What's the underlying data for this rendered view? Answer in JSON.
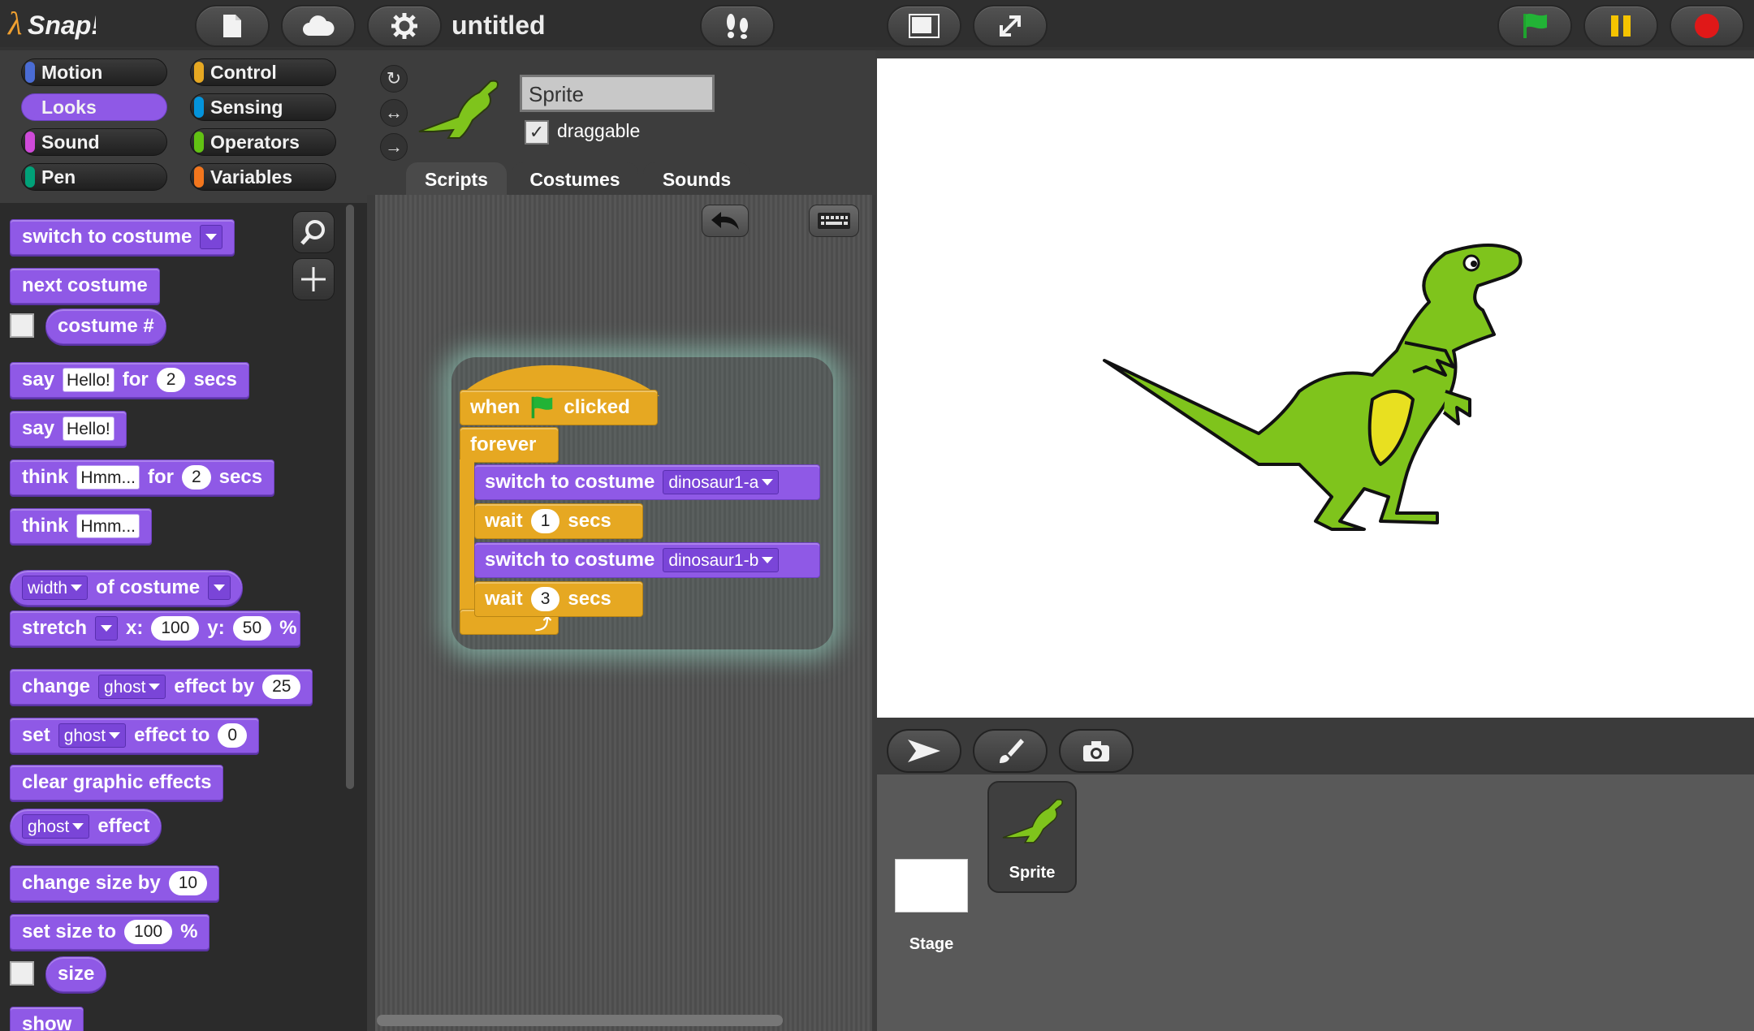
{
  "app": {
    "name": "Snap!",
    "project_title": "untitled"
  },
  "categories": [
    {
      "label": "Motion",
      "color": "#4a6cd4"
    },
    {
      "label": "Control",
      "color": "#e6a822"
    },
    {
      "label": "Looks",
      "color": "#8f59e6",
      "selected": true
    },
    {
      "label": "Sensing",
      "color": "#0494dc"
    },
    {
      "label": "Sound",
      "color": "#cf4ad9"
    },
    {
      "label": "Operators",
      "color": "#62c213"
    },
    {
      "label": "Pen",
      "color": "#00a178"
    },
    {
      "label": "Variables",
      "color": "#f3761d"
    }
  ],
  "palette": {
    "switch_to_costume": "switch to costume",
    "next_costume": "next costume",
    "costume_num": "costume #",
    "say": "say",
    "hello": "Hello!",
    "for": "for",
    "two": "2",
    "secs": "secs",
    "think": "think",
    "hmm": "Hmm...",
    "width": "width",
    "of_costume": "of costume",
    "stretch": "stretch",
    "x": "x:",
    "x_val": "100",
    "y": "y:",
    "y_val": "50",
    "pct": "%",
    "change": "change",
    "ghost": "ghost",
    "effect_by": "effect by",
    "twenty_five": "25",
    "set": "set",
    "effect_to": "effect to",
    "zero": "0",
    "clear_graphic_effects": "clear graphic effects",
    "effect": "effect",
    "change_size_by": "change size by",
    "ten": "10",
    "set_size_to": "set size to",
    "hundred": "100",
    "size": "size",
    "show": "show"
  },
  "sprite": {
    "name": "Sprite",
    "draggable_label": "draggable",
    "draggable_checked": "✓"
  },
  "tabs": [
    "Scripts",
    "Costumes",
    "Sounds"
  ],
  "script": {
    "when": "when",
    "clicked": "clicked",
    "forever": "forever",
    "switch_to_costume": "switch to costume",
    "costume_a": "dinosaur1-a",
    "costume_b": "dinosaur1-b",
    "wait": "wait",
    "wait1": "1",
    "wait2": "3",
    "secs": "secs"
  },
  "corral": {
    "stage_label": "Stage",
    "sprite_label": "Sprite"
  }
}
